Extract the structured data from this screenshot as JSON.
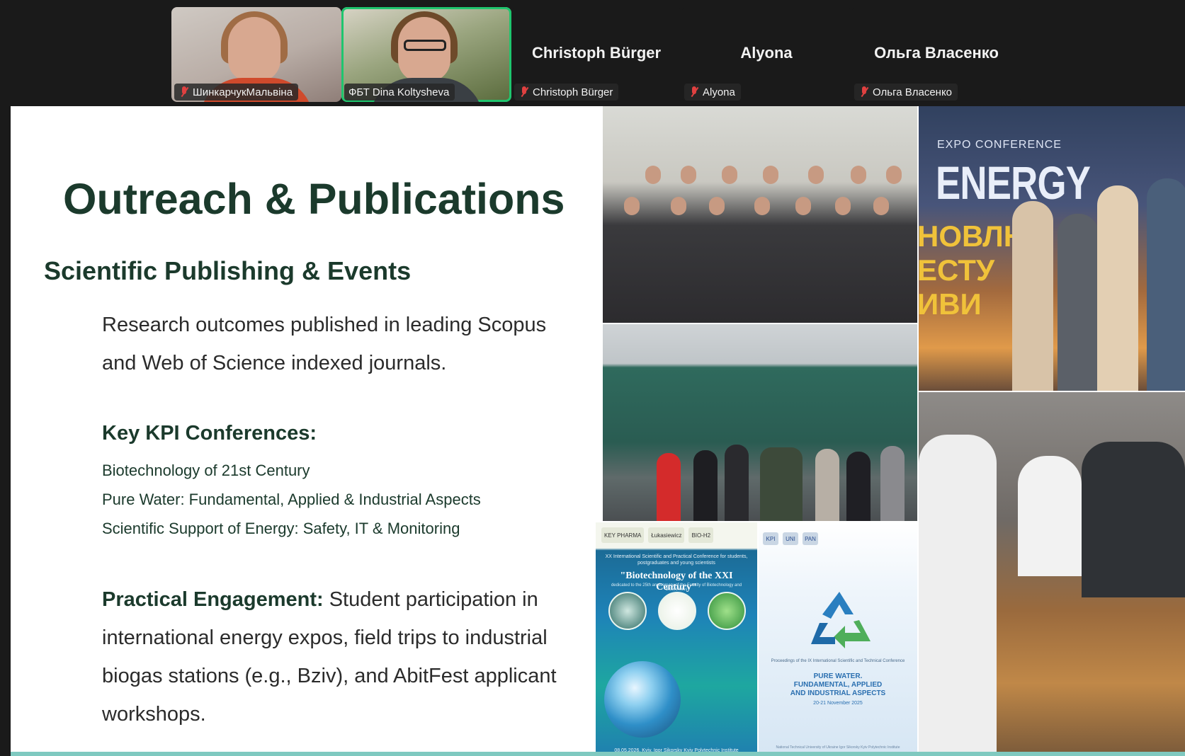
{
  "participants": [
    {
      "name": "ШинкарчукМальвіна",
      "muted": true,
      "video": true,
      "active": false
    },
    {
      "name": "ФБТ Dina Koltysheva",
      "muted": false,
      "video": true,
      "active": true
    },
    {
      "name": "Christoph Bürger",
      "display_name": "Christoph Bürger",
      "muted": true,
      "video": false
    },
    {
      "name": "Alyona",
      "display_name": "Alyona",
      "muted": true,
      "video": false
    },
    {
      "name": "Ольга Власенко",
      "display_name": "Ольга Власенко",
      "muted": true,
      "video": false
    }
  ],
  "slide": {
    "title": "Outreach & Publications",
    "subtitle": "Scientific Publishing & Events",
    "research_text": "Research outcomes published in leading Scopus and Web of Science indexed journals.",
    "kpi_heading": "Key KPI Conferences:",
    "conferences": [
      "Biotechnology of 21st Century",
      "Pure Water: Fundamental, Applied & Industrial Aspects",
      "Scientific Support of Energy: Safety, IT & Monitoring"
    ],
    "engagement_lead": "Practical Engagement:",
    "engagement_text": " Student participation in international energy expos, field trips to industrial biogas stations (e.g., Bziv), and AbitFest applicant workshops."
  },
  "photos": {
    "energy_expo": {
      "small_label": "EXPO  CONFERENCE",
      "big_label": "ENERGY",
      "ua_text": "НОВЛЮ\nЕСТУ\nИВИ"
    },
    "bio_poster": {
      "sponsors": [
        "KEY PHARMA",
        "Łukasiewicz",
        "BIO-H2"
      ],
      "intro": "XX International Scientific and Practical Conference for students, postgraduates and young scientists",
      "title": "\"Biotechnology of the XXI Century\"",
      "subtitle": "dedicated to the 25th anniversary of the Faculty of Biotechnology and Biotechnics",
      "footer": "08.05.2026, Kyiv, Igor Sikorsky Kyiv Polytechnic Institute"
    },
    "water_poster": {
      "logos": [
        "KPI",
        "UNI",
        "PAN"
      ],
      "intro": "Proceedings of the IX International Scientific and Technical Conference",
      "title": "PURE WATER.\nFUNDAMENTAL, APPLIED\nAND  INDUSTRIAL ASPECTS",
      "date": "20-21 November 2025",
      "footer": "National Technical University of Ukraine Igor Sikorsky Kyiv Polytechnic Institute"
    }
  },
  "colors": {
    "active_speaker": "#1fc56e",
    "title_green": "#1b3a2c",
    "mute_red": "#e04040",
    "footer_bar": "#7fc9c0"
  }
}
